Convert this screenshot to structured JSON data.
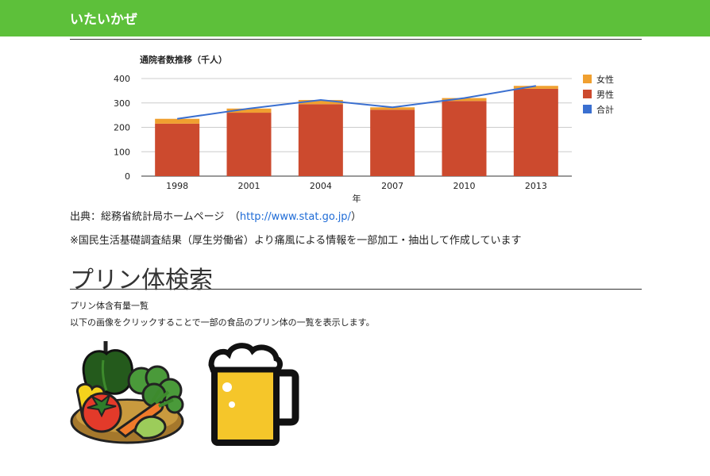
{
  "header": {
    "title": "いたいかぜ"
  },
  "chart_data": {
    "type": "bar",
    "title": "通院者数推移（千人）",
    "xlabel": "年",
    "ylabel": "",
    "ylim": [
      0,
      400
    ],
    "yticks": [
      0,
      100,
      200,
      300,
      400
    ],
    "categories": [
      "1998",
      "2001",
      "2004",
      "2007",
      "2010",
      "2013"
    ],
    "series": [
      {
        "name": "女性",
        "kind": "bar-stack",
        "color": "#f0a030",
        "values": [
          20,
          17,
          17,
          10,
          12,
          12
        ]
      },
      {
        "name": "男性",
        "kind": "bar-stack",
        "color": "#cc4a2e",
        "values": [
          215,
          260,
          295,
          272,
          308,
          358
        ]
      },
      {
        "name": "合計",
        "kind": "line",
        "color": "#3a6fd0",
        "values": [
          235,
          277,
          312,
          282,
          320,
          370
        ]
      }
    ],
    "legend_position": "right",
    "grid": true
  },
  "source": {
    "label": "出典：総務省統計局ホームページ　（",
    "link": "http://www.stat.go.jp/",
    "close": "）"
  },
  "note": "※国民生活基礎調査結果（厚生労働省）より痛風による情報を一部加工・抽出して作成しています",
  "section": {
    "title": "プリン体検索",
    "subtitle": "プリン体含有量一覧",
    "description": "以下の画像をクリックすることで一部の食品のプリン体の一覧を表示します。"
  },
  "images": [
    {
      "icon": "vegetables-icon"
    },
    {
      "icon": "beer-mug-icon"
    }
  ]
}
